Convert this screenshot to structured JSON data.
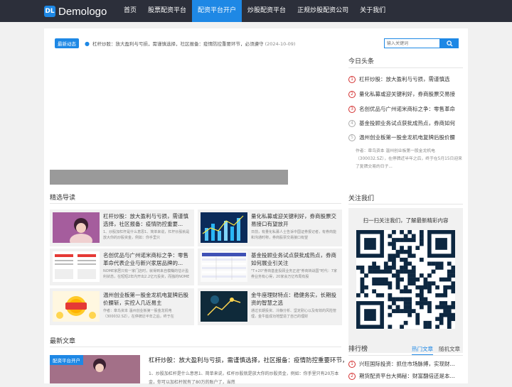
{
  "nav": {
    "logo_text": "Demologo",
    "logo_mark": "DL",
    "items": [
      "首页",
      "股票配资平台",
      "配资平台开户",
      "炒股配资平台",
      "正规炒股配资公司",
      "关于我们"
    ],
    "active_index": 2
  },
  "ticker": {
    "badge": "最新动态",
    "text": "杠杆炒股：放大盈利与亏损，需谨慎选择，社区报备：疫情防控重要环节，必须遵守",
    "date": "(2024-10-09)"
  },
  "search": {
    "placeholder": "输入关键词"
  },
  "featured": {
    "title": "精选导读",
    "items": [
      {
        "title": "杠杆炒股：放大盈利与亏损，需谨慎选择，社区报备：疫情防控重要...",
        "desc": "1、炒股加杠杆是什么意思1、简单来说，杠杆炒股就是放大你的炒股资金，例如：你手里只"
      },
      {
        "title": "量化私募或迎关键利好，券商股票交易接口有望放开",
        "desc": "日前，有量化私募人士告诉中国证券报记者，有券商能和沟通时称，券商股票交易接口有望"
      },
      {
        "title": "名创优品与广州诺米商标之争：零售革命代表企业与新兴家居品牌的...",
        "desc": "NOME家居只有一家门店时，就得到来自模糊的估计盈利状态，在短短2年内开出2.2亿元投资，而独的NOME"
      },
      {
        "title": "基金投顾业务试点获批成热点，券商如何展业引关注",
        "desc": "\"T+20\"券商基金投顾业务正迎\"券商转战国\"时代：7家券业务有心得，20家会万亿布局有股"
      },
      {
        "title": "温州创业板第一股金龙机电复牌后股价腰斩，实控人几近易主",
        "desc": "作者：章鸟资本 温州创业板第一股金龙机电（300032.SZ），在停牌近半年之后，终于在"
      },
      {
        "title": "金牛座理财特点：稳健务实，长期投资的智慧之选",
        "desc": "通过长期投资、冷静分析、坚定耐心以及有效的风险管理，金牛座成功地塑造了自己的理财"
      }
    ]
  },
  "latest": {
    "title": "最新文章",
    "tag": "配资平台开户",
    "item_title": "杠杆炒股：放大盈利与亏损，需谨慎选择，社区报备：疫情防控重要环节，必须遵守",
    "item_desc": "1、炒股加杠杆是什么意思1、简单来说，杠杆炒股就是放大你的炒股资金，例如：你手里只有20万本金，你可以加杠杆就有了80万的账户了，当然"
  },
  "headlines": {
    "title": "今日头条",
    "items": [
      {
        "num": "1",
        "text": "杠杆炒股：放大盈利与亏损，需谨慎选"
      },
      {
        "num": "2",
        "text": "量化私募或迎关键利好，券商股票交易接"
      },
      {
        "num": "3",
        "text": "名创优品与广州诺米商标之争：零售革命"
      },
      {
        "num": "4",
        "text": "基金投顾业务试点获批成热点，券商如何"
      },
      {
        "num": "5",
        "text": "温州创业板第一股金龙机电复牌后股价腰"
      }
    ],
    "note": "作者：章鸟资本 温州创业板第一股金龙机电（300032.SZ），在停牌近半年之后，终于在5月15日迎来了复牌交易的日子..."
  },
  "follow": {
    "title": "关注我们",
    "text": "扫一扫关注我们，了解最新精彩内容"
  },
  "ranking": {
    "title": "排行榜",
    "tab_hot": "热门文章",
    "tab_random": "随机文章",
    "items": [
      {
        "num": "1",
        "text": "兴旺国际投资：抓住市场脉搏，实现财..."
      },
      {
        "num": "2",
        "text": "期货配资平台大揭秘：财富翻倍还是本..."
      }
    ]
  },
  "colors": {
    "accent": "#1e88e5",
    "nav_bg": "#2c2f3a",
    "rank_red": "#d32f2f"
  }
}
